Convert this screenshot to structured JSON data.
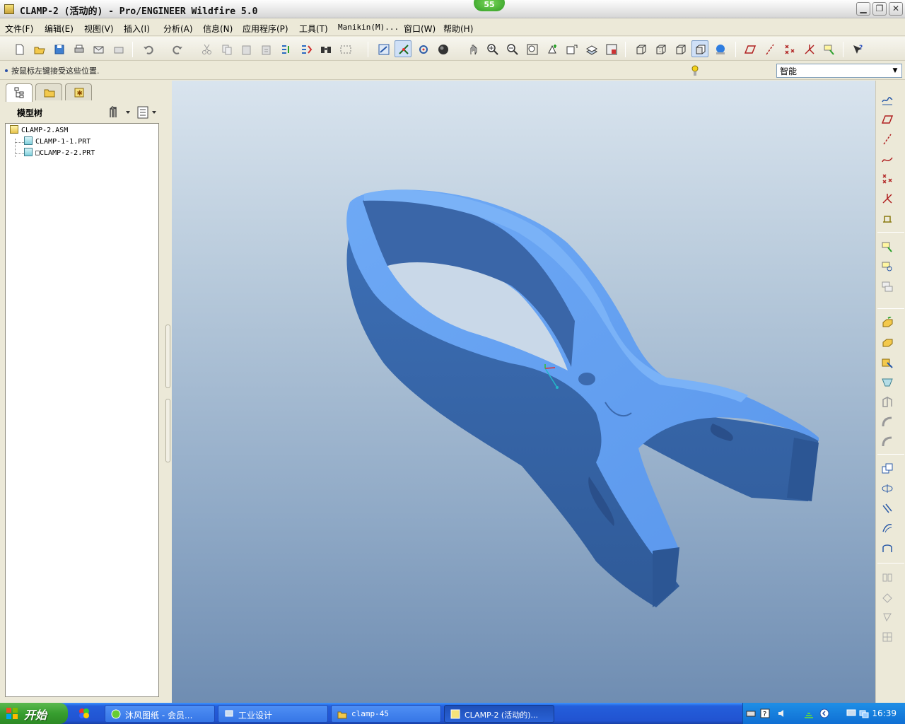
{
  "window": {
    "title": "CLAMP-2 (活动的) - Pro/ENGINEER Wildfire 5.0",
    "badge": "55",
    "minimize_label": "▁",
    "restore_label": "❐",
    "close_label": "✕"
  },
  "menu": [
    "文件(F)",
    "编辑(E)",
    "视图(V)",
    "插入(I)",
    "分析(A)",
    "信息(N)",
    "应用程序(P)",
    "工具(T)",
    "Manikin(M)...",
    "窗口(W)",
    "帮助(H)"
  ],
  "status": {
    "message": "按鼠标左键接受这些位置.",
    "filter_value": "智能"
  },
  "model_tree": {
    "title": "模型树",
    "items": [
      "CLAMP-2.ASM",
      "CLAMP-1-1.PRT",
      "□CLAMP-2-2.PRT"
    ]
  },
  "taskbar": {
    "start_label": "开始",
    "tasks": [
      "沐风图纸 - 会员...",
      "工业设计",
      "clamp-45",
      "CLAMP-2 (活动的)..."
    ],
    "clock": "16:39"
  },
  "colors": {
    "model_blue": "#5e9cf0",
    "viewport_top": "#d9e4ee",
    "viewport_bottom": "#6f8db2"
  }
}
